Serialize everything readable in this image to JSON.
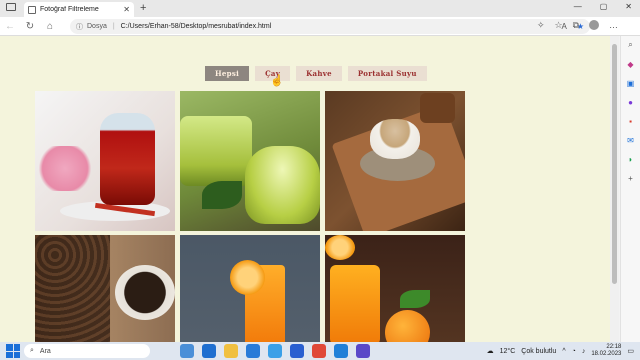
{
  "browser": {
    "tab_title": "Fotoğraf Filtreleme",
    "tab_close": "✕",
    "new_tab": "+",
    "window_controls": [
      "—",
      "▢",
      "✕"
    ],
    "address": {
      "protocol_label": "Dosya",
      "url": "C:/Users/Erhan-58/Desktop/mesrubat/index.html"
    }
  },
  "page": {
    "filters": [
      {
        "label": "Hepsi",
        "active": true
      },
      {
        "label": "Çay",
        "active": false
      },
      {
        "label": "Kahve",
        "active": false
      },
      {
        "label": "Portakal Suyu",
        "active": false
      }
    ],
    "photos": [
      {
        "name": "red-tea-photo"
      },
      {
        "name": "green-tea-photo"
      },
      {
        "name": "turkish-coffee-photo"
      },
      {
        "name": "coffee-beans-photo"
      },
      {
        "name": "orange-juice-glass-photo"
      },
      {
        "name": "orange-juice-jar-photo"
      }
    ]
  },
  "taskbar": {
    "search_label": "Ara",
    "weather_temp": "12°C",
    "weather_desc": "Çok bulutlu",
    "time": "22:18",
    "date": "18.02.2023"
  }
}
